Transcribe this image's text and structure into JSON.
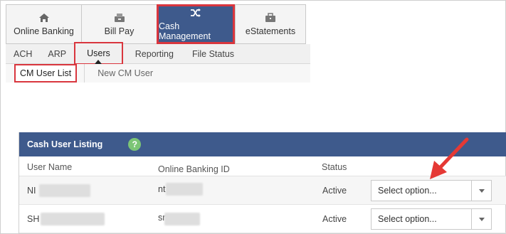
{
  "top_tabs": [
    {
      "label": "Online Banking",
      "icon": "home-icon"
    },
    {
      "label": "Bill Pay",
      "icon": "bill-pay-icon"
    },
    {
      "label": "Cash Management",
      "icon": "shuffle-icon",
      "active": true
    },
    {
      "label": "eStatements",
      "icon": "briefcase-icon"
    }
  ],
  "sub_nav": [
    {
      "label": "ACH"
    },
    {
      "label": "ARP"
    },
    {
      "label": "Users",
      "selected": true
    },
    {
      "label": "Reporting"
    },
    {
      "label": "File Status"
    }
  ],
  "tert_nav": [
    {
      "label": "CM User List",
      "selected": true
    },
    {
      "label": "New CM User"
    }
  ],
  "panel": {
    "title": "Cash User Listing",
    "help_glyph": "?",
    "columns": {
      "user_name": "User Name",
      "online_banking_id": "Online Banking ID",
      "status": "Status"
    },
    "rows": [
      {
        "user_name_prefix": "NI",
        "online_id_prefix": "nt",
        "status": "Active",
        "select_placeholder": "Select option..."
      },
      {
        "user_name_prefix": "SH",
        "online_id_prefix": "sr",
        "status": "Active",
        "select_placeholder": "Select option..."
      }
    ]
  },
  "colors": {
    "brand": "#3e5a8c",
    "highlight": "#d9363e",
    "help": "#7cc576"
  }
}
